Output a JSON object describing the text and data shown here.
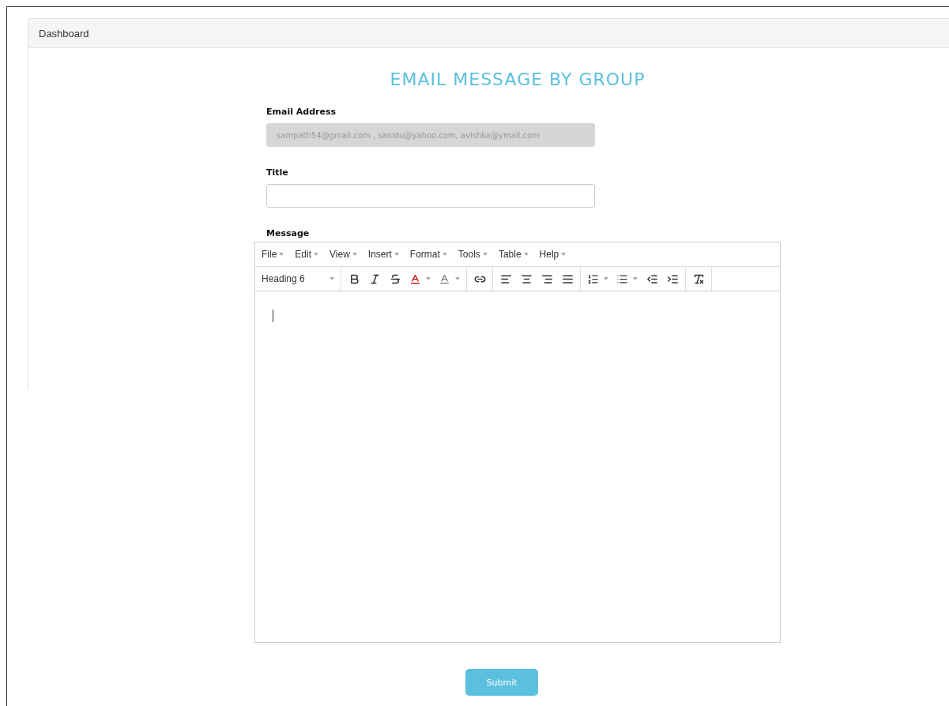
{
  "panel": {
    "title": "Dashboard"
  },
  "heading": "EMAIL MESSAGE BY GROUP",
  "email_field": {
    "label": "Email Address",
    "value": "sampath54@gmail.com , sanidu@yahoo.com, avishka@ymail.com",
    "disabled": true
  },
  "title_field": {
    "label": "Title"
  },
  "message": {
    "label": "Message",
    "menus": [
      "File",
      "Edit",
      "View",
      "Insert",
      "Format",
      "Tools",
      "Table",
      "Help"
    ],
    "block_format": "Heading 6"
  },
  "submit": "Submit"
}
